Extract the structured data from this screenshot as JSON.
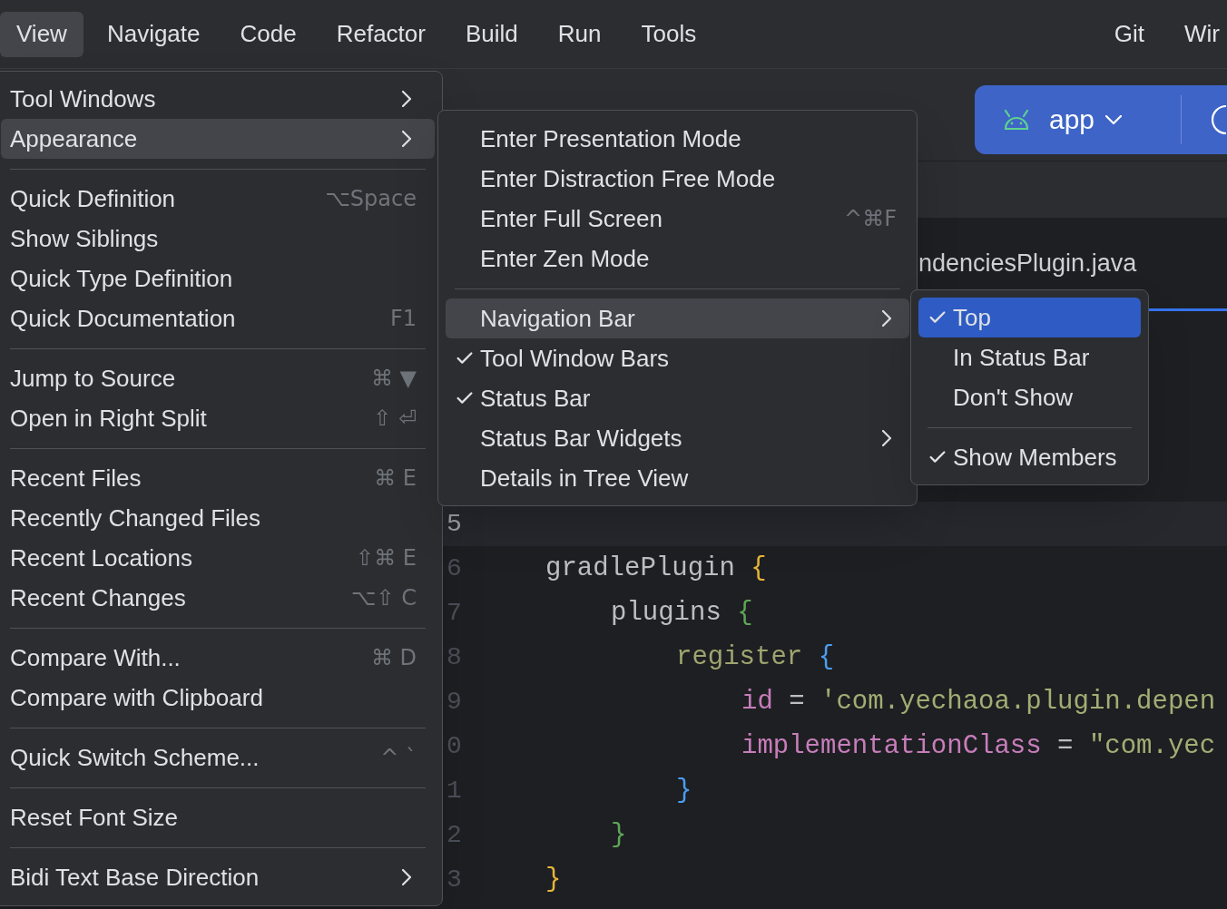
{
  "menu_bar": {
    "items": [
      {
        "label": "View",
        "selected": true
      },
      {
        "label": "Navigate",
        "selected": false
      },
      {
        "label": "Code",
        "selected": false
      },
      {
        "label": "Refactor",
        "selected": false
      },
      {
        "label": "Build",
        "selected": false
      },
      {
        "label": "Run",
        "selected": false
      },
      {
        "label": "Tools",
        "selected": false
      }
    ],
    "right_items": [
      {
        "label": "Git",
        "selected": false
      },
      {
        "label": "Wir",
        "selected": false
      }
    ]
  },
  "toolbar": {
    "run_config": {
      "label": "app"
    }
  },
  "editor": {
    "tab": {
      "label": "ndenciesPlugin.java",
      "selected": true
    },
    "lines": [
      {
        "number": "5",
        "current": true
      },
      {
        "number": "6",
        "current": false,
        "tokens": [
          {
            "text": "gradlePlugin ",
            "kind": "ident"
          },
          {
            "text": "{",
            "kind": "brace1"
          }
        ],
        "children": [
          {
            "number": "7",
            "current": false,
            "tokens": [
              {
                "text": "plugins ",
                "kind": "ident"
              },
              {
                "text": "{",
                "kind": "brace2"
              }
            ],
            "children": [
              {
                "number": "8",
                "current": false,
                "tokens": [
                  {
                    "text": "register ",
                    "kind": "call"
                  },
                  {
                    "text": "{",
                    "kind": "brace3"
                  }
                ],
                "children": [
                  {
                    "number": "9",
                    "current": false,
                    "tokens": [
                      {
                        "text": "id",
                        "kind": "prop"
                      },
                      {
                        "text": " = ",
                        "kind": "ident"
                      },
                      {
                        "text": "'com.yechaoa.plugin.depen",
                        "kind": "string"
                      }
                    ]
                  },
                  {
                    "number": "0",
                    "current": false,
                    "tokens": [
                      {
                        "text": "implementationClass",
                        "kind": "prop"
                      },
                      {
                        "text": " = ",
                        "kind": "ident"
                      },
                      {
                        "text": "\"com.yec",
                        "kind": "string"
                      }
                    ]
                  }
                ]
              },
              {
                "number": "1",
                "current": false,
                "tokens": [
                  {
                    "text": "}",
                    "kind": "brace3"
                  }
                ]
              }
            ]
          },
          {
            "number": "2",
            "current": false,
            "tokens": [
              {
                "text": "}",
                "kind": "brace2"
              }
            ]
          }
        ]
      },
      {
        "number": "3",
        "current": false,
        "tokens": [
          {
            "text": "}",
            "kind": "brace1"
          }
        ]
      }
    ]
  },
  "view_menu": {
    "items": [
      {
        "kind": "item",
        "label": "Tool Windows",
        "submenu": true,
        "selected": false
      },
      {
        "kind": "item",
        "label": "Appearance",
        "submenu": true,
        "selected": true
      },
      {
        "kind": "separator"
      },
      {
        "kind": "item",
        "label": "Quick Definition",
        "shortcut": "⌥Space",
        "selected": false
      },
      {
        "kind": "item",
        "label": "Show Siblings",
        "selected": false
      },
      {
        "kind": "item",
        "label": "Quick Type Definition",
        "selected": false
      },
      {
        "kind": "item",
        "label": "Quick Documentation",
        "shortcut": "F1",
        "selected": false
      },
      {
        "kind": "separator"
      },
      {
        "kind": "item",
        "label": "Jump to Source",
        "shortcut": "⌘ ▼",
        "selected": false
      },
      {
        "kind": "item",
        "label": "Open in Right Split",
        "shortcut": "⇧ ⏎",
        "selected": false
      },
      {
        "kind": "separator"
      },
      {
        "kind": "item",
        "label": "Recent Files",
        "shortcut": "⌘ E",
        "selected": false
      },
      {
        "kind": "item",
        "label": "Recently Changed Files",
        "selected": false
      },
      {
        "kind": "item",
        "label": "Recent Locations",
        "shortcut": "⇧⌘ E",
        "selected": false
      },
      {
        "kind": "item",
        "label": "Recent Changes",
        "shortcut": "⌥⇧ C",
        "selected": false
      },
      {
        "kind": "separator"
      },
      {
        "kind": "item",
        "label": "Compare With...",
        "shortcut": "⌘ D",
        "selected": false
      },
      {
        "kind": "item",
        "label": "Compare with Clipboard",
        "selected": false
      },
      {
        "kind": "separator"
      },
      {
        "kind": "item",
        "label": "Quick Switch Scheme...",
        "shortcut": "^ `",
        "selected": false
      },
      {
        "kind": "separator"
      },
      {
        "kind": "item",
        "label": "Reset Font Size",
        "selected": false
      },
      {
        "kind": "separator"
      },
      {
        "kind": "item",
        "label": "Bidi Text Base Direction",
        "submenu": true,
        "selected": false
      }
    ]
  },
  "appearance_menu": {
    "items": [
      {
        "kind": "item",
        "label": "Enter Presentation Mode",
        "checked": false,
        "selected": false
      },
      {
        "kind": "item",
        "label": "Enter Distraction Free Mode",
        "checked": false,
        "selected": false
      },
      {
        "kind": "item",
        "label": "Enter Full Screen",
        "shortcut": "^⌘F",
        "checked": false,
        "selected": false
      },
      {
        "kind": "item",
        "label": "Enter Zen Mode",
        "checked": false,
        "selected": false
      },
      {
        "kind": "separator"
      },
      {
        "kind": "item",
        "label": "Navigation Bar",
        "submenu": true,
        "checked": false,
        "selected": true
      },
      {
        "kind": "item",
        "label": "Tool Window Bars",
        "checked": true,
        "selected": false
      },
      {
        "kind": "item",
        "label": "Status Bar",
        "checked": true,
        "selected": false
      },
      {
        "kind": "item",
        "label": "Status Bar Widgets",
        "submenu": true,
        "checked": false,
        "selected": false
      },
      {
        "kind": "item",
        "label": "Details in Tree View",
        "checked": false,
        "selected": false
      }
    ]
  },
  "navigation_bar_menu": {
    "items": [
      {
        "kind": "item",
        "label": "Top",
        "checked": true,
        "selected": true
      },
      {
        "kind": "item",
        "label": "In Status Bar",
        "checked": false,
        "selected": false
      },
      {
        "kind": "item",
        "label": "Don't Show",
        "checked": false,
        "selected": false
      },
      {
        "kind": "separator"
      },
      {
        "kind": "item",
        "label": "Show Members",
        "checked": true,
        "selected": false
      }
    ]
  }
}
